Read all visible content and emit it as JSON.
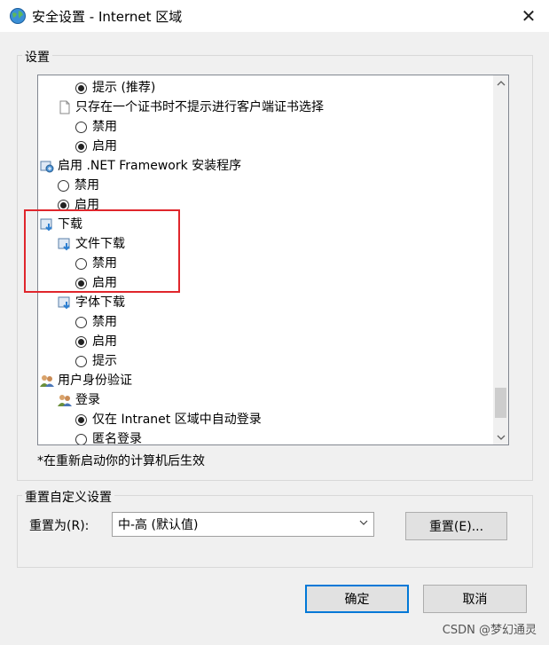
{
  "window": {
    "title": "安全设置 - Internet 区域",
    "close_glyph": "✕"
  },
  "settings_group": {
    "label": "设置",
    "items": [
      {
        "kind": "radio",
        "checked": true,
        "label": "提示 (推荐)"
      },
      {
        "kind": "doc-node",
        "icon": "document-icon",
        "label": "只存在一个证书时不提示进行客户端证书选择"
      },
      {
        "kind": "radio",
        "checked": false,
        "label": "禁用"
      },
      {
        "kind": "radio",
        "checked": true,
        "label": "启用"
      },
      {
        "kind": "node",
        "icon": "settings-node-icon",
        "label": "启用 .NET Framework 安装程序"
      },
      {
        "kind": "radio",
        "checked": false,
        "label": "禁用"
      },
      {
        "kind": "radio",
        "checked": true,
        "label": "启用"
      },
      {
        "kind": "node",
        "icon": "download-node-icon",
        "label": "下载"
      },
      {
        "kind": "node",
        "icon": "download-node-icon",
        "label": "文件下载"
      },
      {
        "kind": "radio",
        "checked": false,
        "label": "禁用"
      },
      {
        "kind": "radio",
        "checked": true,
        "label": "启用"
      },
      {
        "kind": "node",
        "icon": "download-node-icon",
        "label": "字体下载"
      },
      {
        "kind": "radio",
        "checked": false,
        "label": "禁用"
      },
      {
        "kind": "radio",
        "checked": true,
        "label": "启用"
      },
      {
        "kind": "radio",
        "checked": false,
        "label": "提示"
      },
      {
        "kind": "node",
        "icon": "users-node-icon",
        "label": "用户身份验证"
      },
      {
        "kind": "node",
        "icon": "users-node-icon",
        "label": "登录"
      },
      {
        "kind": "radio",
        "checked": true,
        "label": "仅在 Intranet 区域中自动登录"
      },
      {
        "kind": "radio",
        "checked": false,
        "label": "匿名登录"
      }
    ],
    "footnote": "*在重新启动你的计算机后生效"
  },
  "reset_group": {
    "label": "重置自定义设置",
    "reset_to_label": "重置为(R):",
    "selected_level": "中-高 (默认值)",
    "reset_button": "重置(E)..."
  },
  "footer": {
    "ok_button": "确定",
    "cancel_button": "取消"
  },
  "watermark": "CSDN @梦幻通灵",
  "colors": {
    "highlight_box": "#e0262c",
    "primary_button_border": "#0078d7"
  }
}
